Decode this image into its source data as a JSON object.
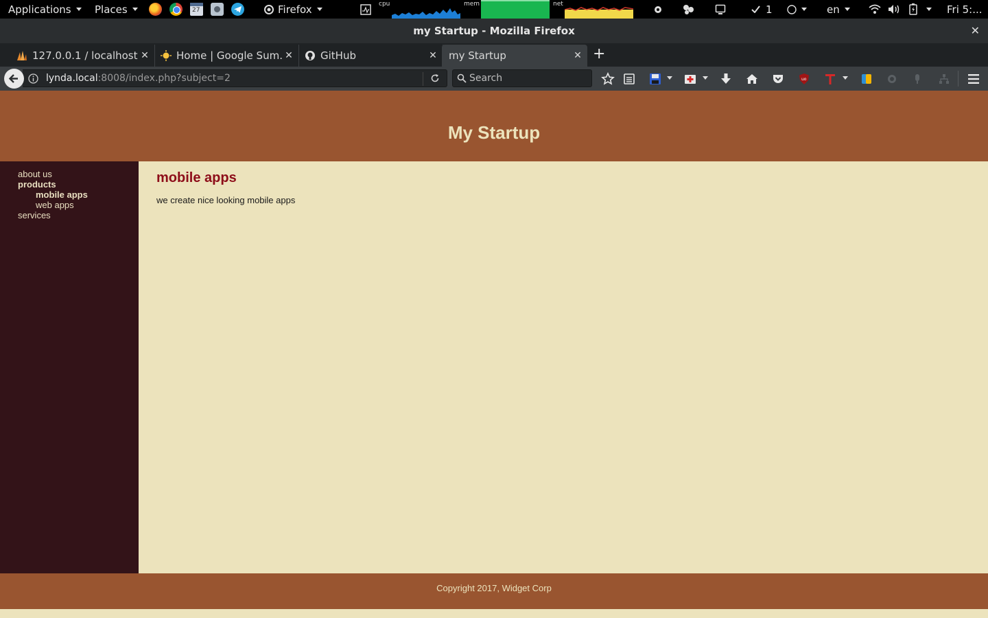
{
  "topbar": {
    "applications": "Applications",
    "places": "Places",
    "app_menu": "Firefox",
    "cpu_label": "cpu",
    "mem_label": "mem",
    "net_label": "net",
    "task_count": "1",
    "language": "en",
    "clock": "Fri 5:..."
  },
  "window": {
    "title": "my Startup - Mozilla Firefox"
  },
  "tabs": [
    {
      "label": "127.0.0.1 / localhost /...",
      "icon": "phpmyadmin-icon"
    },
    {
      "label": "Home | Google Sum...",
      "icon": "sun-icon"
    },
    {
      "label": "GitHub",
      "icon": "github-icon"
    },
    {
      "label": "my Startup",
      "icon": "none",
      "active": true
    }
  ],
  "navbar": {
    "url_host": "lynda.local",
    "url_rest": ":8008/index.php?subject=2",
    "search_placeholder": "Search"
  },
  "site": {
    "header_title": "My Startup",
    "nav": {
      "subjects": [
        {
          "label": "about us",
          "selected": false
        },
        {
          "label": "products",
          "selected": true
        },
        {
          "label": "services",
          "selected": false
        }
      ],
      "pages": [
        {
          "label": "mobile apps",
          "selected": true
        },
        {
          "label": "web apps",
          "selected": false
        }
      ]
    },
    "main": {
      "heading": "mobile apps",
      "body": "we create nice looking mobile apps"
    },
    "footer": "Copyright 2017, Widget Corp"
  },
  "colors": {
    "header_bg": "#995530",
    "sidebar_bg": "#331318",
    "content_bg": "#ece3bc",
    "heading": "#8d0d19"
  }
}
